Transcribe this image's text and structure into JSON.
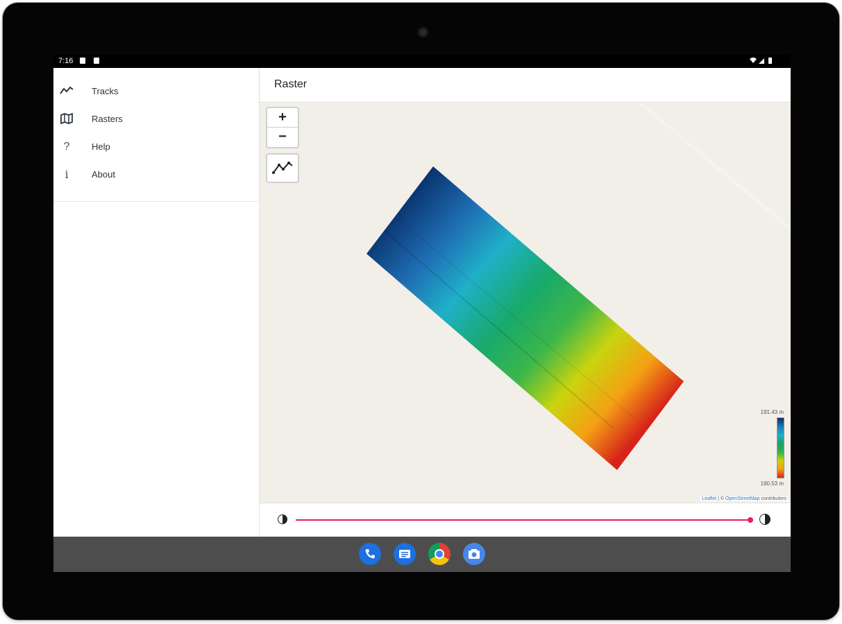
{
  "status_bar": {
    "time": "7:16"
  },
  "drawer": {
    "items": [
      {
        "label": "Tracks",
        "icon": "tracks-icon"
      },
      {
        "label": "Rasters",
        "icon": "map-icon"
      },
      {
        "label": "Help",
        "icon": "help-icon"
      },
      {
        "label": "About",
        "icon": "info-icon"
      }
    ]
  },
  "appbar": {
    "title": "Raster"
  },
  "map": {
    "zoom_in_label": "+",
    "zoom_out_label": "−",
    "legend": {
      "max_label": "191.43 m",
      "min_label": "190.53 m",
      "colors": [
        "#08306b",
        "#1f78b4",
        "#1fb0c8",
        "#15a36b",
        "#38b24a",
        "#c8d10e",
        "#f29e12",
        "#d6241a"
      ]
    },
    "attribution": {
      "leaflet": "Leaflet",
      "separator": "| ©",
      "osm": "OpenStreetMap",
      "suffix": "contributors"
    }
  },
  "opacity": {
    "value": 1.0
  },
  "dock": {
    "apps": [
      "phone-app-icon",
      "messages-app-icon",
      "chrome-app-icon",
      "camera-app-icon"
    ]
  },
  "colors": {
    "accent": "#e91e63",
    "map_background": "#f2efe9",
    "nav_bar": "#4d4d4d"
  }
}
